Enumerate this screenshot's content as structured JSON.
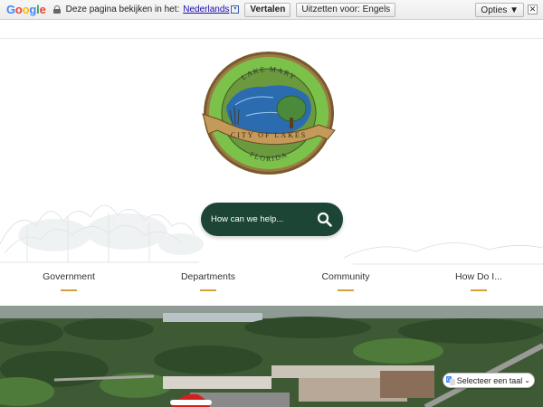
{
  "translate_bar": {
    "logo": "Google",
    "message": "Deze pagina bekijken in het:",
    "language": "Nederlands",
    "dropdown_glyph": "▾",
    "translate_button": "Vertalen",
    "off_button": "Uitzetten voor: Engels",
    "options_button": "Opties ▼",
    "close_glyph": "✕"
  },
  "seal": {
    "top_text": "LAKE MARY",
    "ribbon_text": "CITY OF LAKES",
    "bottom_text": "FLORIDA"
  },
  "search": {
    "placeholder": "How can we help...",
    "icon": "search-icon"
  },
  "nav": {
    "items": [
      {
        "label": "Government"
      },
      {
        "label": "Departments"
      },
      {
        "label": "Community"
      },
      {
        "label": "How Do I..."
      }
    ]
  },
  "language_selector": {
    "label": "Selecteer een taal",
    "icon": "google-translate-icon"
  },
  "colors": {
    "search_bg": "#1c4535",
    "nav_underline": "#d5a036",
    "seal_green": "#7cc24a",
    "seal_blue": "#2b6cb0",
    "seal_ring": "#8a6a3a"
  }
}
